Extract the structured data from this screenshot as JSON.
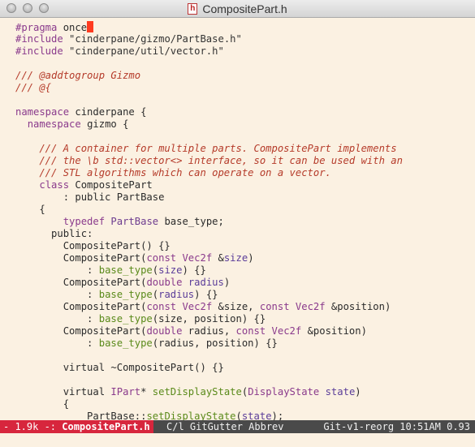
{
  "window": {
    "title": "CompositePart.h",
    "doc_icon": "h"
  },
  "editor": {
    "lines": [
      {
        "text": "#pragma once",
        "kind": "pragma"
      },
      {
        "text": "#include \"cinderpane/gizmo/PartBase.h\"",
        "kind": "include"
      },
      {
        "text": "#include \"cinderpane/util/vector.h\"",
        "kind": "include"
      },
      {
        "text": "",
        "kind": "blank"
      },
      {
        "text": "/// @addtogroup Gizmo",
        "kind": "comment"
      },
      {
        "text": "/// @{",
        "kind": "comment"
      },
      {
        "text": "",
        "kind": "blank"
      },
      {
        "text": "namespace cinderpane {",
        "kind": "code"
      },
      {
        "text": "  namespace gizmo {",
        "kind": "code"
      },
      {
        "text": "",
        "kind": "blank"
      },
      {
        "text": "    /// A container for multiple parts. CompositePart implements",
        "kind": "comment"
      },
      {
        "text": "    /// the \\b std::vector<> interface, so it can be used with an",
        "kind": "comment"
      },
      {
        "text": "    /// STL algorithms which can operate on a vector.",
        "kind": "comment"
      },
      {
        "text": "    class CompositePart",
        "kind": "code"
      },
      {
        "text": "        : public PartBase",
        "kind": "code"
      },
      {
        "text": "    {",
        "kind": "code"
      },
      {
        "text": "        typedef PartBase base_type;",
        "kind": "code"
      },
      {
        "text": "      public:",
        "kind": "code"
      },
      {
        "text": "        CompositePart() {}",
        "kind": "code"
      },
      {
        "text": "        CompositePart(const Vec2f &size)",
        "kind": "code"
      },
      {
        "text": "            : base_type(size) {}",
        "kind": "code"
      },
      {
        "text": "        CompositePart(double radius)",
        "kind": "code"
      },
      {
        "text": "            : base_type(radius) {}",
        "kind": "code"
      },
      {
        "text": "        CompositePart(const Vec2f &size, const Vec2f &position)",
        "kind": "code"
      },
      {
        "text": "            : base_type(size, position) {}",
        "kind": "code"
      },
      {
        "text": "        CompositePart(double radius, const Vec2f &position)",
        "kind": "code"
      },
      {
        "text": "            : base_type(radius, position) {}",
        "kind": "code"
      },
      {
        "text": "",
        "kind": "blank"
      },
      {
        "text": "        virtual ~CompositePart() {}",
        "kind": "code"
      },
      {
        "text": "",
        "kind": "blank"
      },
      {
        "text": "        virtual IPart* setDisplayState(DisplayState state)",
        "kind": "code"
      },
      {
        "text": "        {",
        "kind": "code"
      },
      {
        "text": "            PartBase::setDisplayState(state);",
        "kind": "code"
      }
    ]
  },
  "modeline": {
    "state": "- 1.9k -: ",
    "buffer_name": "CompositePart.h",
    "modes": "C/l GitGutter Abbrev",
    "vcs": "Git-v1-reorg",
    "time": "10:51AM",
    "load": "0.93"
  },
  "colors": {
    "background": "#fbf1e2",
    "modeline_bg": "#4a4a4a",
    "modeline_accent": "#d7263d",
    "cursor": "#ff3b1f",
    "comment": "#b53b2a",
    "keyword": "#8a3a8c"
  }
}
